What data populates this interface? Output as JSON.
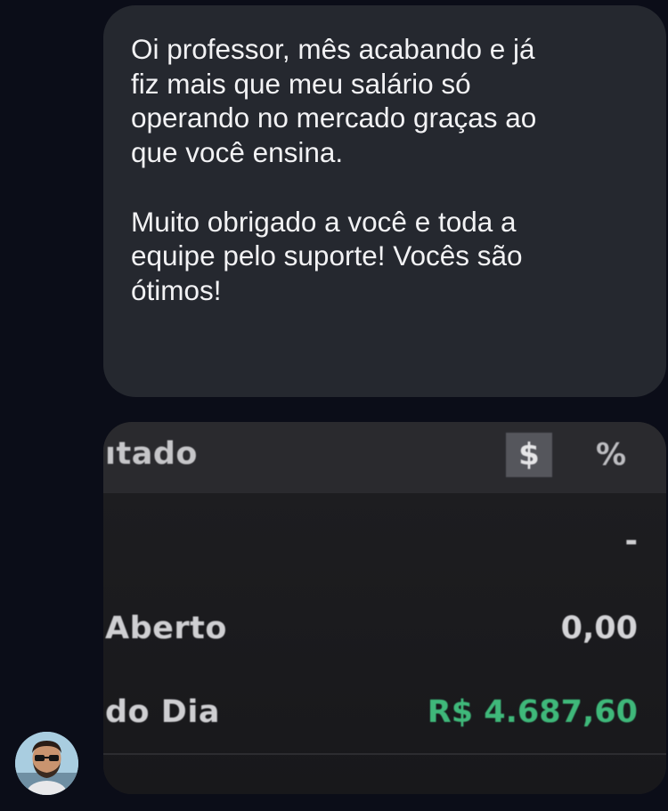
{
  "message": {
    "paragraphs": [
      "Oi professor, mês acabando e já\nfiz mais que meu salário só\noperando no mercado graças ao\nque você ensina.",
      "Muito obrigado a você e toda a\nequipe pelo suporte! Vocês são\nótimos!"
    ]
  },
  "attachment": {
    "header_title": "ıtado",
    "currency_toggle": "$",
    "percent_toggle": "%",
    "rows": [
      {
        "label": "",
        "value": "-"
      },
      {
        "label": "Aberto",
        "value": "0,00"
      },
      {
        "label": "do Dia",
        "value": "R$ 4.687,60"
      }
    ],
    "colors": {
      "positive_value": "#3fb87a"
    }
  },
  "avatar": {
    "icon": "user-avatar-photo"
  },
  "colors": {
    "background": "#0b0d18",
    "bubble": "#25282f",
    "text": "#f2f2f4"
  }
}
